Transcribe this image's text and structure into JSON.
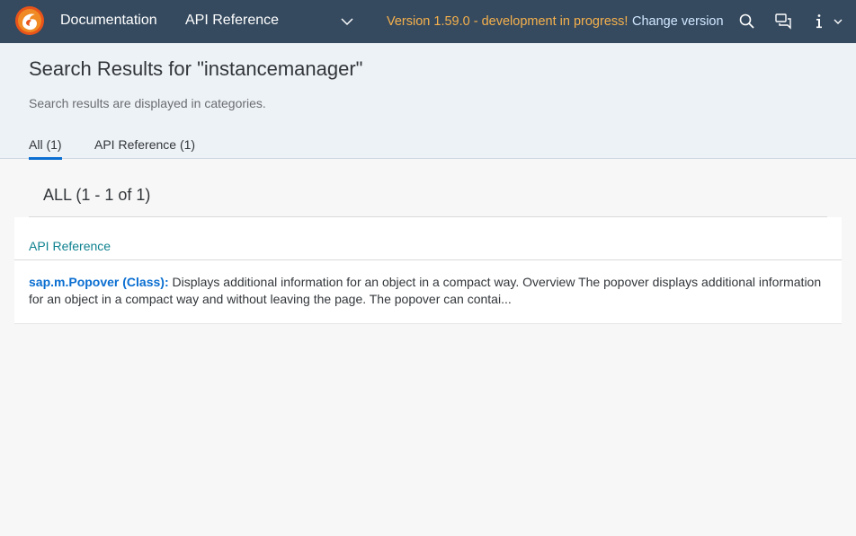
{
  "shell": {
    "logo_icon": "openui5-logo-icon",
    "nav_documentation": "Documentation",
    "nav_api_reference": "API Reference",
    "nav_dropdown_icon": "chevron-down-icon",
    "version_text": "Version 1.59.0 - development in progress!",
    "change_version": "Change version",
    "search_icon": "search-icon",
    "feedback_icon": "feedback-icon",
    "info_icon": "info-icon",
    "colors": {
      "bar": "#354a5f",
      "version": "#f5b04c",
      "link": "#d1e8ff"
    }
  },
  "header": {
    "title": "Search Results for \"instancemanager\"",
    "subtitle": "Search results are displayed in categories.",
    "tabs": [
      {
        "label": "All (1)",
        "selected": true
      },
      {
        "label": "API Reference (1)",
        "selected": false
      }
    ]
  },
  "content": {
    "section_title": "ALL (1 - 1 of 1)",
    "group_header": "API Reference",
    "results": [
      {
        "title": "sap.m.Popover (Class):",
        "snippet": " Displays additional information for an object in a compact way. Overview The popover displays additional information for an object in a compact way and without leaving the page. The popover can contai..."
      }
    ]
  }
}
